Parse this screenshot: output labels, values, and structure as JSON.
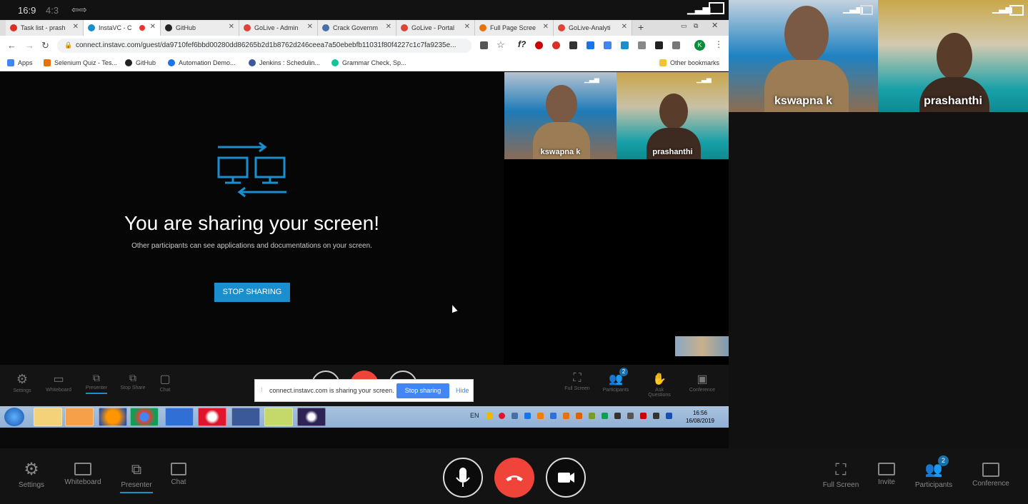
{
  "inner_top": {
    "ratio_169": "16:9",
    "ratio_43": "4:3"
  },
  "tabs": [
    {
      "label": "Task list - prash",
      "color": "#d93025"
    },
    {
      "label": "InstaVC - C",
      "color": "#1a8fd0"
    },
    {
      "label": "GitHub",
      "color": "#222222"
    },
    {
      "label": "GoLive - Admin",
      "color": "#db4437"
    },
    {
      "label": "Crack Governm",
      "color": "#4a6fa5"
    },
    {
      "label": "GoLive - Portal",
      "color": "#db4437"
    },
    {
      "label": "Full Page Scree",
      "color": "#e8710a"
    },
    {
      "label": "GoLive-Analyti",
      "color": "#db4437"
    }
  ],
  "address": {
    "url": "connect.instavc.com/guest/da9710fef6bbd00280dd86265b2d1b8762d246ceea7a50ebebfb11031f80f4227c1c7fa9235e..."
  },
  "bookmarks": [
    {
      "label": "Apps",
      "color": "#4285f4"
    },
    {
      "label": "Selenium Quiz - Tes...",
      "color": "#e8710a"
    },
    {
      "label": "GitHub",
      "color": "#222222"
    },
    {
      "label": "Automation Demo...",
      "color": "#1a73e8"
    },
    {
      "label": "Jenkins : Schedulin...",
      "color": "#3b5998"
    },
    {
      "label": "Grammar Check, Sp...",
      "color": "#15c39a"
    }
  ],
  "other_bookmarks": "Other bookmarks",
  "sharing": {
    "title": "You are sharing your screen!",
    "subtitle": "Other participants can see applications and documentations on your screen.",
    "stop_label": "STOP SHARING"
  },
  "participants": [
    {
      "name": "kswapna k"
    },
    {
      "name": "prashanthi"
    }
  ],
  "inner_toolbar": {
    "settings": "Settings",
    "whiteboard": "Whiteboard",
    "presenter": "Presenter",
    "stop_share": "Stop Share",
    "chat": "Chat",
    "full_screen": "Full Screen",
    "participants": "Participants",
    "participants_count": "2",
    "ask_questions": "Ask Questions",
    "conference": "Conference"
  },
  "notification": {
    "text": "connect.instavc.com is sharing your screen.",
    "stop_label": "Stop sharing",
    "hide_label": "Hide"
  },
  "taskbar": {
    "lang": "EN",
    "time": "16:56",
    "date": "16/08/2019"
  },
  "outer_toolbar": {
    "settings": "Settings",
    "whiteboard": "Whiteboard",
    "presenter": "Presenter",
    "chat": "Chat",
    "full_screen": "Full Screen",
    "invite": "Invite",
    "participants": "Participants",
    "participants_count": "2",
    "conference": "Conference"
  },
  "colors": {
    "accent": "#1a8fd0",
    "end_call": "#f0443a"
  }
}
